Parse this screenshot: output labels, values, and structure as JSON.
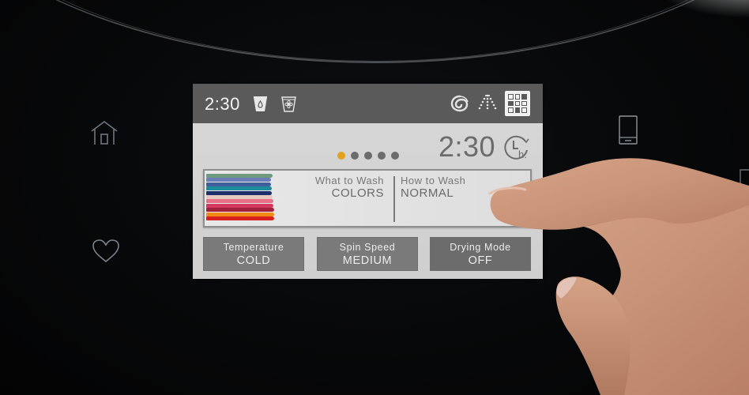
{
  "status_bar": {
    "time": "2:30",
    "left_icons": [
      "water-drop-cup-icon",
      "flower-cup-icon"
    ],
    "right_icons": [
      "swirl-icon",
      "spray-icon",
      "grid-menu-icon"
    ]
  },
  "main": {
    "page_dots": {
      "count": 5,
      "active_index": 0
    },
    "remaining_time": "2:30",
    "timer_icon": "clock-hours-icon",
    "wash_card": {
      "what_to_wash_label": "What to Wash",
      "what_to_wash_value": "COLORS",
      "how_to_wash_label": "How to Wash",
      "how_to_wash_value": "NORMAL"
    },
    "options": [
      {
        "label": "Temperature",
        "value": "COLD"
      },
      {
        "label": "Spin Speed",
        "value": "MEDIUM"
      },
      {
        "label": "Drying Mode",
        "value": "OFF"
      }
    ]
  },
  "side_buttons": {
    "left": [
      "home-icon",
      "heart-icon"
    ],
    "right": [
      "phone-icon",
      "gear-icon"
    ]
  },
  "colors": {
    "accent_dot": "#e2a21d",
    "status_bar": "#5a5a5a",
    "screen_bg": "#d2d2d2",
    "option_button": "#7a7a7a"
  }
}
